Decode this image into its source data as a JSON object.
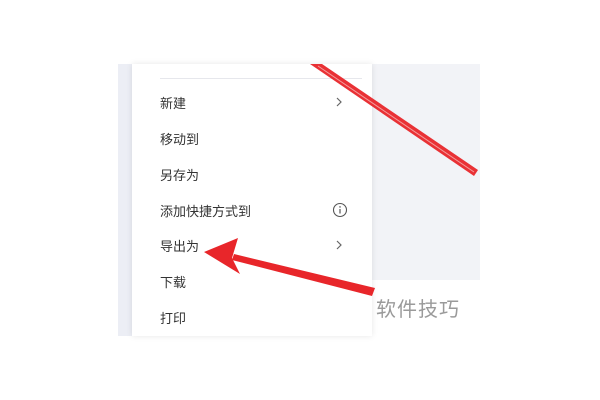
{
  "menu": {
    "items": [
      {
        "label": "新建",
        "has_submenu": true
      },
      {
        "label": "移动到"
      },
      {
        "label": "另存为"
      },
      {
        "label": "添加快捷方式到",
        "has_info": true
      },
      {
        "label": "导出为",
        "has_submenu": true
      },
      {
        "label": "下载"
      },
      {
        "label": "打印"
      }
    ]
  },
  "watermark": {
    "text": "软件技巧"
  },
  "icons": {
    "submenu": "chevron-right-icon",
    "info": "info-circle-icon"
  },
  "colors": {
    "annotation_arrow": "#e8262a",
    "menu_text": "#333333",
    "panel_bg": "#f2f3f7"
  }
}
